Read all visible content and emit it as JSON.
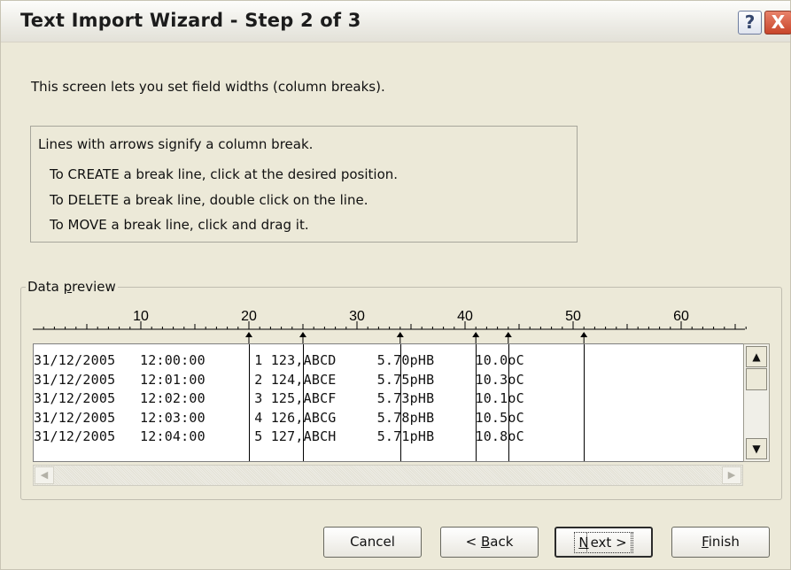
{
  "window": {
    "title": "Text Import Wizard - Step 2 of 3",
    "help_glyph": "?",
    "close_glyph": "X"
  },
  "description": "This screen lets you set field widths (column breaks).",
  "instructions": {
    "heading": "Lines with arrows signify a column break.",
    "create": "To CREATE a break line, click at the desired position.",
    "delete": "To DELETE a break line, double click on the line.",
    "move": "To MOVE a break line, click and drag it."
  },
  "data_preview": {
    "label": "Data preview",
    "label_access_key": "p",
    "ruler_labels": [
      "10",
      "20",
      "30",
      "40",
      "50",
      "60"
    ],
    "break_positions": [
      20,
      25,
      34,
      41,
      44,
      51
    ],
    "rows": [
      "31/12/2005   12:00:00      1 123,ABCD     5.70pHB     10.0oC",
      "31/12/2005   12:01:00      2 124,ABCE     5.75pHB     10.3oC",
      "31/12/2005   12:02:00      3 125,ABCF     5.73pHB     10.1oC",
      "31/12/2005   12:03:00      4 126,ABCG     5.78pHB     10.5oC",
      "31/12/2005   12:04:00      5 127,ABCH     5.71pHB     10.8oC"
    ]
  },
  "scrollbars": {
    "up_icon": "▲",
    "down_icon": "▼",
    "left_icon": "◀",
    "right_icon": "▶"
  },
  "buttons": {
    "cancel": "Cancel",
    "back_prefix": "< ",
    "back_key": "B",
    "back_rest": "ack",
    "next_key": "N",
    "next_rest": "ext >",
    "finish_key": "F",
    "finish_rest": "inish"
  }
}
